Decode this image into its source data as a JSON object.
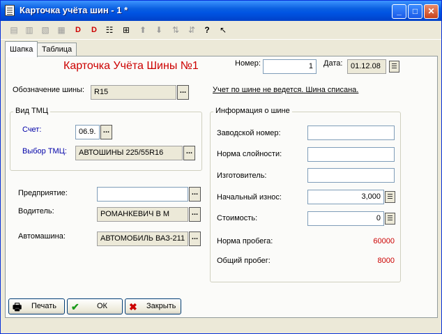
{
  "window": {
    "title": "Карточка учёта шин - 1 *",
    "min_icon": "minimize-icon",
    "max_icon": "maximize-icon",
    "close_icon": "close-icon"
  },
  "toolbar": {
    "icons": [
      "new-record-icon",
      "new-copy-icon",
      "delete-icon",
      "edit-icon",
      "delete-mark-icon",
      "unmark-icon",
      "properties-icon",
      "move-icon",
      "arrow-up-icon",
      "arrow-down-icon",
      "sort-asc-icon",
      "sort-desc-icon",
      "help-icon",
      "context-help-icon"
    ]
  },
  "tabs": [
    {
      "label": "Шапка"
    },
    {
      "label": "Таблица"
    }
  ],
  "header": {
    "heading": "Карточка Учёта Шины №1",
    "number_label": "Номер:",
    "number_value": "1",
    "date_label": "Дата:",
    "date_value": "01.12.08",
    "tire_label": "Обозначение шины:",
    "tire_value": "R15",
    "status_link": "Учет по шине не ведется. Шина списана."
  },
  "tmc": {
    "legend": "Вид ТМЦ",
    "account_label": "Счет:",
    "account_value": "06.9.",
    "choice_label": "Выбор ТМЦ:",
    "choice_value": "АВТОШИНЫ 225/55R16"
  },
  "left": {
    "enterprise_label": "Предприятие:",
    "enterprise_value": "",
    "driver_label": "Водитель:",
    "driver_value": "РОМАНКЕВИЧ В М",
    "car_label": "Автомашина:",
    "car_value": "АВТОМОБИЛЬ ВАЗ-211"
  },
  "info": {
    "legend": "Информация о шине",
    "serial_label": "Заводской номер:",
    "serial_value": "",
    "norm_label": "Норма слойности:",
    "norm_value": "",
    "maker_label": "Изготовитель:",
    "maker_value": "",
    "wear_label": "Начальный износ:",
    "wear_value": "3,000",
    "cost_label": "Стоимость:",
    "cost_value": "0",
    "mileage_norm_label": "Норма пробега:",
    "mileage_norm_value": "60000",
    "total_label": "Общий пробег:",
    "total_value": "8000"
  },
  "buttons": {
    "print": "Печать",
    "ok": "ОК",
    "close": "Закрыть"
  },
  "colors": {
    "title_bar": "#0054e3",
    "heading": "#cc0000",
    "blue_label": "#0000a8"
  }
}
